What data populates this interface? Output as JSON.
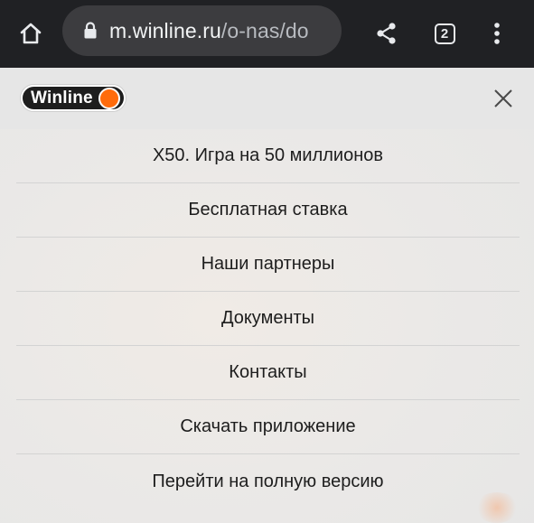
{
  "browser": {
    "url_host": "m.winline.ru",
    "url_path": "/o-nas/do",
    "tab_count": "2",
    "icons": {
      "home": "home-icon",
      "lock": "lock-icon",
      "share": "share-icon",
      "tabs": "tab-switcher-icon",
      "more": "more-vertical-icon"
    }
  },
  "header": {
    "logo_text": "Winline",
    "logo_accent_color": "#ff6b0b",
    "close_icon": "close-icon"
  },
  "menu": {
    "items": [
      {
        "label": "X50. Игра на 50 миллионов"
      },
      {
        "label": "Бесплатная ставка"
      },
      {
        "label": "Наши партнеры"
      },
      {
        "label": "Документы"
      },
      {
        "label": "Контакты"
      },
      {
        "label": "Скачать приложение"
      },
      {
        "label": "Перейти на полную версию"
      }
    ]
  }
}
